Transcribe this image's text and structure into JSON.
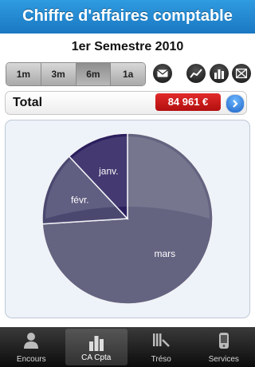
{
  "header": {
    "title": "Chiffre d'affaires comptable"
  },
  "period": {
    "label": "1er Semestre 2010"
  },
  "segments": [
    {
      "label": "1m",
      "active": false
    },
    {
      "label": "3m",
      "active": false
    },
    {
      "label": "6m",
      "active": true
    },
    {
      "label": "1a",
      "active": false
    }
  ],
  "icons": [
    "mail-icon",
    "line-chart-icon",
    "bar-chart-icon",
    "grid-icon"
  ],
  "total": {
    "label": "Total",
    "amount": "84 961 €"
  },
  "chart_data": {
    "type": "pie",
    "slices": [
      {
        "label": "mars",
        "value": 74,
        "color": "#646380"
      },
      {
        "label": "févr.",
        "value": 14,
        "color": "#4b4870"
      },
      {
        "label": "janv.",
        "value": 12,
        "color": "#2b1f5e"
      }
    ]
  },
  "tabs": [
    {
      "label": "Encours",
      "icon": "person-icon",
      "active": false
    },
    {
      "label": "CA Cpta",
      "icon": "bar-chart-icon",
      "active": true
    },
    {
      "label": "Tréso",
      "icon": "ledger-icon",
      "active": false
    },
    {
      "label": "Services",
      "icon": "phone-icon",
      "active": false
    }
  ]
}
